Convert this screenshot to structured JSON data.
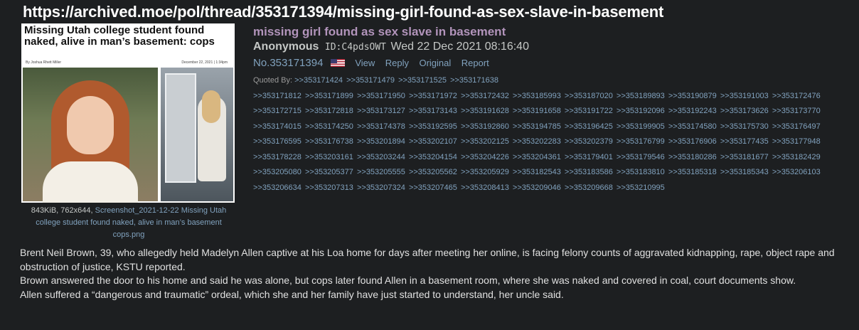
{
  "banner": {
    "url": "https://archived.moe/pol/thread/353171394/missing-girl-found-as-sex-slave-in-basement"
  },
  "thumbnail": {
    "headline": "Missing Utah college student found naked, alive in man’s basement: cops",
    "byline": "By Joshua Rhett Miller",
    "date": "December 22, 2021 | 1:34pm"
  },
  "file": {
    "meta": "843KiB, 762x644,",
    "filename": "Screenshot_2021-12-22 Missing Utah college student found naked, alive in man’s basement cops.png"
  },
  "post": {
    "subject": "missing girl found as sex slave in basement",
    "name": "Anonymous",
    "poster_id": "ID:C4pdsOWT",
    "datetime": "Wed 22 Dec 2021 08:16:40",
    "number": "No.353171394",
    "flag": "us-flag-icon",
    "actions": [
      "View",
      "Reply",
      "Original",
      "Report"
    ],
    "quoted_by_label": "Quoted By:",
    "quoted_by": [
      ">>353171424",
      ">>353171479",
      ">>353171525",
      ">>353171638",
      ">>353171812",
      ">>353171899",
      ">>353171950",
      ">>353171972",
      ">>353172432",
      ">>353185993",
      ">>353187020",
      ">>353189893",
      ">>353190879",
      ">>353191003",
      ">>353172476",
      ">>353172715",
      ">>353172818",
      ">>353173127",
      ">>353173143",
      ">>353191628",
      ">>353191658",
      ">>353191722",
      ">>353192096",
      ">>353192243",
      ">>353173626",
      ">>353173770",
      ">>353174015",
      ">>353174250",
      ">>353174378",
      ">>353192595",
      ">>353192860",
      ">>353194785",
      ">>353196425",
      ">>353199905",
      ">>353174580",
      ">>353175730",
      ">>353176497",
      ">>353176595",
      ">>353176738",
      ">>353201894",
      ">>353202107",
      ">>353202125",
      ">>353202283",
      ">>353202379",
      ">>353176799",
      ">>353176906",
      ">>353177435",
      ">>353177948",
      ">>353178228",
      ">>353203161",
      ">>353203244",
      ">>353204154",
      ">>353204226",
      ">>353204361",
      ">>353179401",
      ">>353179546",
      ">>353180286",
      ">>353181677",
      ">>353182429",
      ">>353205080",
      ">>353205377",
      ">>353205555",
      ">>353205562",
      ">>353205929",
      ">>353182543",
      ">>353183586",
      ">>353183810",
      ">>353185318",
      ">>353185343",
      ">>353206103",
      ">>353206634",
      ">>353207313",
      ">>353207324",
      ">>353207465",
      ">>353208413",
      ">>353209046",
      ">>353209668",
      ">>353210995"
    ],
    "body": [
      "Brent Neil Brown, 39, who allegedly held Madelyn Allen captive at his Loa home for days after meeting her online, is facing felony counts of aggravated kidnapping, rape, object rape and obstruction of justice, KSTU reported.",
      "Brown answered the door to his home and said he was alone, but cops later found Allen in a basement room, where she was naked and covered in coal, court documents show.",
      "Allen suffered a “dangerous and traumatic” ordeal, which she and her family have just started to understand, her uncle said."
    ]
  },
  "colors": {
    "background": "#1d1f21",
    "subject": "#b294bb",
    "link": "#81a2be",
    "text": "#c5c8c6"
  }
}
